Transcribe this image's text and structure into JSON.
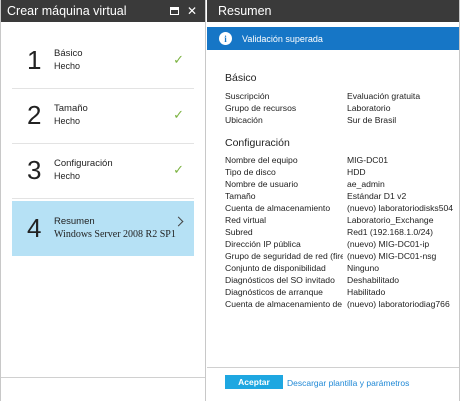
{
  "left_blade": {
    "title": "Crear máquina virtual",
    "steps": [
      {
        "number": "1",
        "name": "Básico",
        "status": "Hecho",
        "completed": true
      },
      {
        "number": "2",
        "name": "Tamaño",
        "status": "Hecho",
        "completed": true
      },
      {
        "number": "3",
        "name": "Configuración",
        "status": "Hecho",
        "completed": true
      },
      {
        "number": "4",
        "name": "Resumen",
        "status": "Windows Server 2008 R2 SP1",
        "completed": false,
        "active": true
      }
    ]
  },
  "right_blade": {
    "title": "Resumen",
    "banner": "Validación superada",
    "basic": {
      "title": "Básico",
      "rows": [
        {
          "label": "Suscripción",
          "value": "Evaluación gratuita"
        },
        {
          "label": "Grupo de recursos",
          "value": "Laboratorio"
        },
        {
          "label": "Ubicación",
          "value": "Sur de Brasil"
        }
      ]
    },
    "config": {
      "title": "Configuración",
      "rows": [
        {
          "label": "Nombre del equipo",
          "value": "MIG-DC01"
        },
        {
          "label": "Tipo de disco",
          "value": "HDD"
        },
        {
          "label": "Nombre de usuario",
          "value": "ae_admin"
        },
        {
          "label": "Tamaño",
          "value": "Estándar D1 v2"
        },
        {
          "label": "Cuenta de almacenamiento",
          "value": "(nuevo) laboratoriodisks504"
        },
        {
          "label": "Red virtual",
          "value": "Laboratorio_Exchange"
        },
        {
          "label": "Subred",
          "value": "Red1 (192.168.1.0/24)"
        },
        {
          "label": "Dirección IP pública",
          "value": "(nuevo) MIG-DC01-ip"
        },
        {
          "label": "Grupo de seguridad de red (fire...",
          "value": "(nuevo) MIG-DC01-nsg"
        },
        {
          "label": "Conjunto de disponibilidad",
          "value": "Ninguno"
        },
        {
          "label": "Diagnósticos del SO invitado",
          "value": "Deshabilitado"
        },
        {
          "label": "Diagnósticos de arranque",
          "value": "Habilitado"
        },
        {
          "label": "Cuenta de almacenamiento de ...",
          "value": "(nuevo) laboratoriodiag766"
        }
      ]
    },
    "accept_label": "Aceptar",
    "download_label": "Descargar plantilla y parámetros"
  },
  "colors": {
    "header_bg": "#3a3a3a",
    "banner_bg": "#1676c6",
    "active_step_bg": "#b6e1f5",
    "check": "#7cb342",
    "accept_bg": "#1ea7e1",
    "link": "#1e88d6"
  },
  "icons": {
    "maximize": "maximize-icon",
    "close": "close-icon",
    "check": "checkmark-icon",
    "chevron": "chevron-right-icon",
    "info": "info-icon"
  }
}
